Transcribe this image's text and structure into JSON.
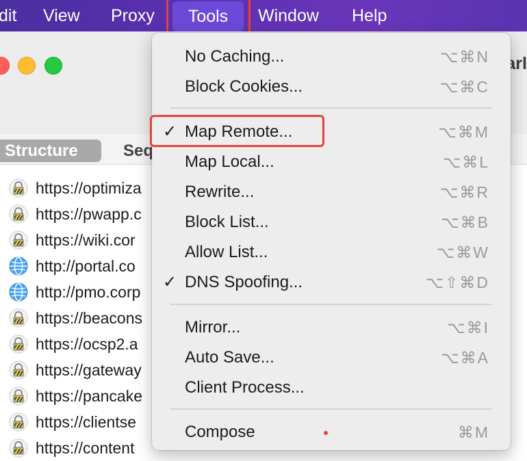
{
  "menubar": {
    "items": [
      "dit",
      "View",
      "Proxy",
      "Tools",
      "Window",
      "Help"
    ],
    "active": "Tools"
  },
  "window": {
    "title_fragment": "arl",
    "tabs": {
      "structure": "Structure",
      "sequence": "Seq"
    },
    "urls": [
      {
        "text": "https://optimiza",
        "icon": "lock-icon"
      },
      {
        "text": "https://pwapp.c",
        "icon": "lock-icon"
      },
      {
        "text": "https://wiki.cor",
        "icon": "lock-icon"
      },
      {
        "text": "http://portal.co",
        "icon": "globe-icon"
      },
      {
        "text": "http://pmo.corp",
        "icon": "globe-icon"
      },
      {
        "text": "https://beacons",
        "icon": "lock-icon"
      },
      {
        "text": "https://ocsp2.a",
        "icon": "lock-icon"
      },
      {
        "text": "https://gateway",
        "icon": "lock-icon"
      },
      {
        "text": "https://pancake",
        "icon": "lock-icon"
      },
      {
        "text": "https://clientse",
        "icon": "lock-icon"
      },
      {
        "text": "https://content",
        "icon": "lock-icon"
      }
    ]
  },
  "tools_menu": {
    "items": [
      {
        "label": "No Caching...",
        "shortcut": "⌥⌘N",
        "checked": false
      },
      {
        "label": "Block Cookies...",
        "shortcut": "⌥⌘C",
        "checked": false
      },
      {
        "label": "Map Remote...",
        "shortcut": "⌥⌘M",
        "checked": true
      },
      {
        "label": "Map Local...",
        "shortcut": "⌥⌘L",
        "checked": false
      },
      {
        "label": "Rewrite...",
        "shortcut": "⌥⌘R",
        "checked": false
      },
      {
        "label": "Block List...",
        "shortcut": "⌥⌘B",
        "checked": false
      },
      {
        "label": "Allow List...",
        "shortcut": "⌥⌘W",
        "checked": false
      },
      {
        "label": "DNS Spoofing...",
        "shortcut": "⌥⇧⌘D",
        "checked": true
      },
      {
        "label": "Mirror...",
        "shortcut": "⌥⌘I",
        "checked": false
      },
      {
        "label": "Auto Save...",
        "shortcut": "⌥⌘A",
        "checked": false
      },
      {
        "label": "Client Process...",
        "shortcut": "",
        "checked": false
      },
      {
        "label": "Compose",
        "shortcut": "⌘M",
        "checked": false
      }
    ],
    "check_glyph": "✓"
  },
  "colors": {
    "menubar": "#5b2fb0",
    "highlight": "#e8413a",
    "menu_bg": "#ededed"
  }
}
